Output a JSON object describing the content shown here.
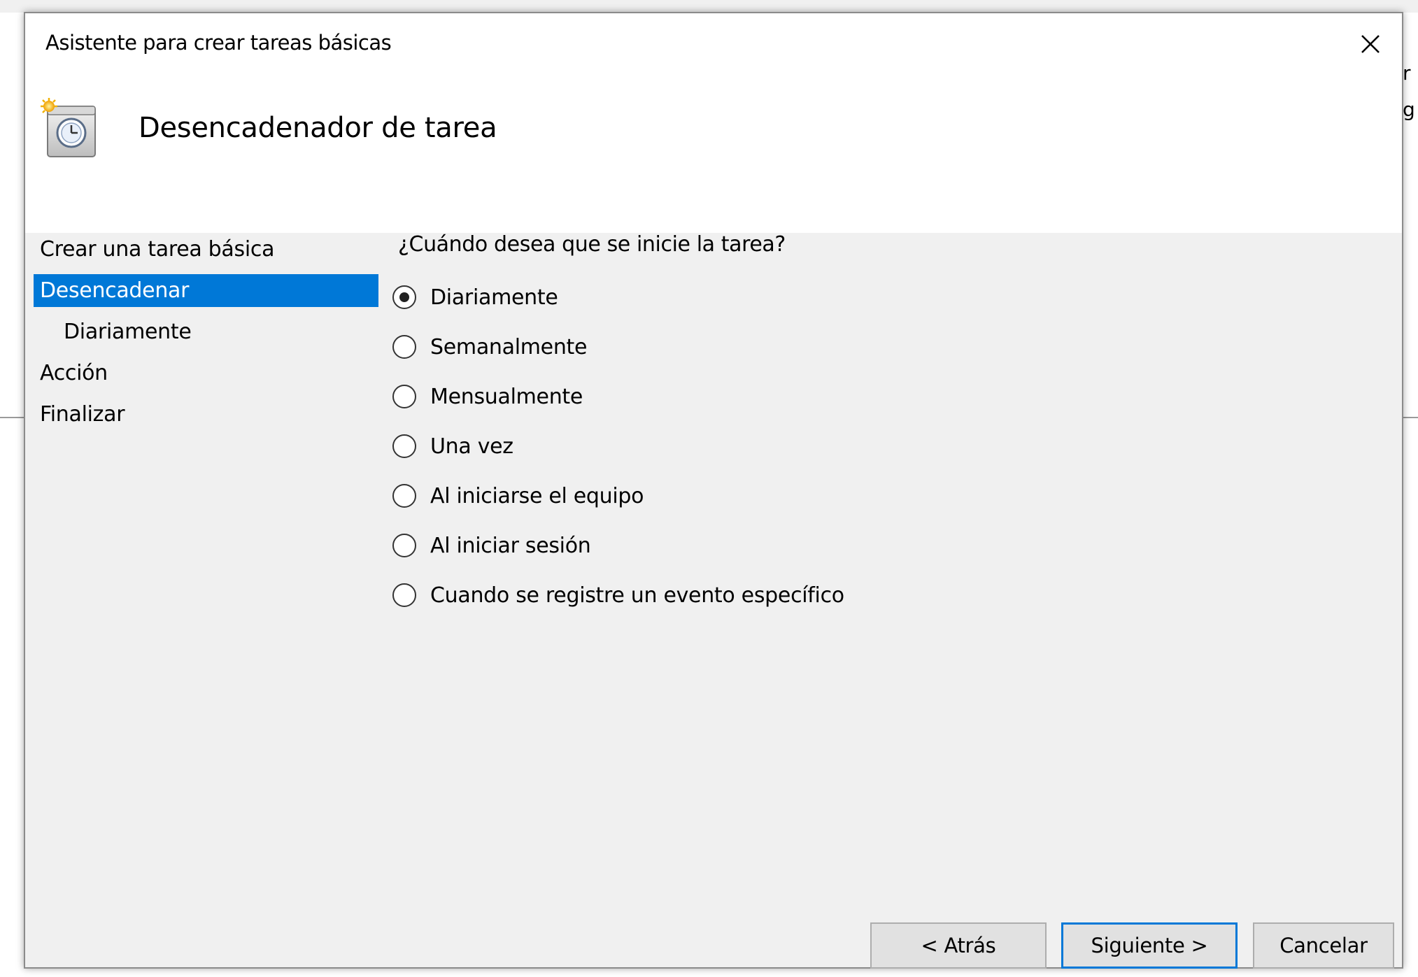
{
  "window": {
    "title": "Asistente para crear tareas básicas",
    "close_icon": "close-icon"
  },
  "header": {
    "title": "Desencadenador de tarea",
    "icon": "calendar-clock-icon"
  },
  "steps": [
    {
      "label": "Crear una tarea básica",
      "active": false
    },
    {
      "label": "Desencadenar",
      "active": true
    },
    {
      "label": "Diariamente",
      "active": false,
      "sub": true
    },
    {
      "label": "Acción",
      "active": false
    },
    {
      "label": "Finalizar",
      "active": false
    }
  ],
  "content": {
    "question": "¿Cuándo desea que se inicie la tarea?",
    "options": [
      {
        "label": "Diariamente",
        "checked": true
      },
      {
        "label": "Semanalmente",
        "checked": false
      },
      {
        "label": "Mensualmente",
        "checked": false
      },
      {
        "label": "Una vez",
        "checked": false
      },
      {
        "label": "Al iniciarse el equipo",
        "checked": false
      },
      {
        "label": "Al iniciar sesión",
        "checked": false
      },
      {
        "label": "Cuando se registre un evento específico",
        "checked": false
      }
    ]
  },
  "buttons": {
    "back": "< Atrás",
    "next": "Siguiente >",
    "cancel": "Cancelar"
  },
  "background": {
    "edge_text_1": "r",
    "edge_text_2": "g"
  },
  "colors": {
    "accent": "#0078d7",
    "dialog_bg": "#f0f0f0",
    "header_bg": "#ffffff"
  }
}
